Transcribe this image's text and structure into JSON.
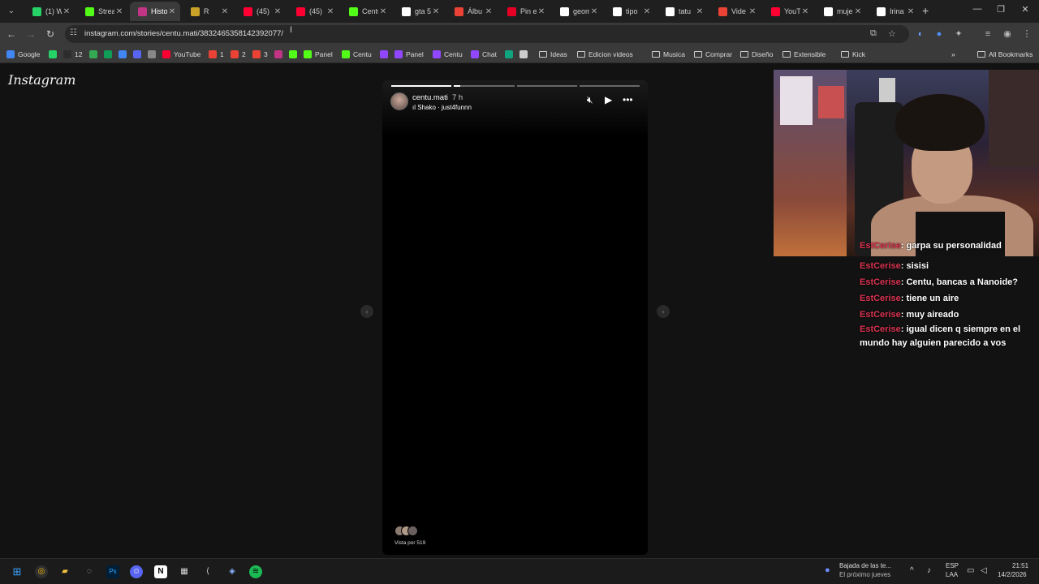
{
  "browser": {
    "tabs": [
      {
        "label": "(1) W",
        "color": "#25d366"
      },
      {
        "label": "Strea",
        "color": "#53fc18"
      },
      {
        "label": "Histo",
        "color": "#c13584",
        "active": true
      },
      {
        "label": "R",
        "color": "#c9a227"
      },
      {
        "label": "(45)",
        "color": "#ff0033"
      },
      {
        "label": "(45)",
        "color": "#ff0033"
      },
      {
        "label": "Centu",
        "color": "#53fc18"
      },
      {
        "label": "gta 5",
        "color": "#ffffff"
      },
      {
        "label": "Álbu",
        "color": "#ea4335"
      },
      {
        "label": "Pin e",
        "color": "#e60023"
      },
      {
        "label": "geom",
        "color": "#ffffff"
      },
      {
        "label": "tipo",
        "color": "#ffffff"
      },
      {
        "label": "tatu",
        "color": "#ffffff"
      },
      {
        "label": "Vide",
        "color": "#ea4335"
      },
      {
        "label": "YouT",
        "color": "#ff0033"
      },
      {
        "label": "muje",
        "color": "#ffffff"
      },
      {
        "label": "Irina",
        "color": "#ffffff"
      }
    ],
    "url": "instagram.com/stories/centu.mati/3832465358142392077/",
    "bookmarks": [
      {
        "label": "Google",
        "color": "#4285f4"
      },
      {
        "label": "",
        "color": "#25d366"
      },
      {
        "label": "12",
        "color": "#2d2d2d"
      },
      {
        "label": "",
        "color": "#34a853"
      },
      {
        "label": "",
        "color": "#0f9d58"
      },
      {
        "label": "",
        "color": "#4285f4"
      },
      {
        "label": "",
        "color": "#5865f2"
      },
      {
        "label": "",
        "color": "#888888"
      },
      {
        "label": "YouTube",
        "color": "#ff0033"
      },
      {
        "label": "1",
        "color": "#ea4335"
      },
      {
        "label": "2",
        "color": "#ea4335"
      },
      {
        "label": "3",
        "color": "#ea4335"
      },
      {
        "label": "",
        "color": "#c13584"
      },
      {
        "label": "",
        "color": "#53fc18"
      },
      {
        "label": "Panel",
        "color": "#53fc18"
      },
      {
        "label": "Centu",
        "color": "#53fc18"
      },
      {
        "label": "",
        "color": "#9146ff"
      },
      {
        "label": "Panel",
        "color": "#9146ff"
      },
      {
        "label": "Centu",
        "color": "#9146ff"
      },
      {
        "label": "Chat",
        "color": "#9146ff"
      },
      {
        "label": "",
        "color": "#10a37f"
      },
      {
        "label": "",
        "color": "#cccccc"
      }
    ],
    "folders": [
      "Ideas",
      "Edicion videos",
      "Musica",
      "Comprar",
      "Diseño",
      "Extensible",
      "Kick"
    ],
    "all_bookmarks": "All Bookmarks"
  },
  "instagram": {
    "logo": "Instagram",
    "story": {
      "username": "centu.mati",
      "time": "7 h",
      "music": "Shako · just4funnn",
      "viewers": "Vista por 519",
      "segments": 4,
      "current_segment_progress": 0.1,
      "current_segment": 2
    }
  },
  "stream_chat": {
    "first_partial": {
      "user": "EstCerise",
      "text": ": garpa su personalidad"
    },
    "messages": [
      {
        "user": "EstCerise",
        "text": ": sisisi"
      },
      {
        "user": "EstCerise",
        "text": ": Centu, bancas a Nanoide?"
      },
      {
        "user": "EstCerise",
        "text": ": tiene un aire"
      },
      {
        "user": "EstCerise",
        "text": ": muy aireado"
      },
      {
        "user": "EstCerise",
        "text": ": igual dicen q siempre en el mundo hay alguien parecido a vos"
      }
    ]
  },
  "taskbar": {
    "notification_title": "Bajada de las te...",
    "notification_sub": "El próximo jueves",
    "lang1": "ESP",
    "lang2": "LAA",
    "time": "21:51",
    "date": "14/2/2026"
  }
}
